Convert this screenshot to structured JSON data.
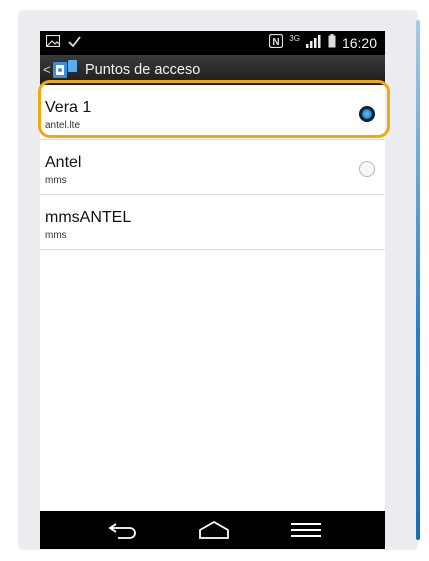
{
  "status_bar": {
    "icons": [
      "gallery-icon",
      "check-icon",
      "nfc-icon",
      "3g-icon",
      "signal-icon",
      "battery-icon"
    ],
    "network_label": "3G",
    "nfc_label": "N",
    "time": "16:20"
  },
  "action_bar": {
    "title": "Puntos de acceso",
    "back_glyph": "<"
  },
  "apn_list": [
    {
      "name": "Vera 1",
      "apn": "antel.lte",
      "selected": true
    },
    {
      "name": "Antel",
      "apn": "mms",
      "selected": false
    },
    {
      "name": "mmsANTEL",
      "apn": "mms",
      "selected": null
    }
  ],
  "nav_bar": {
    "buttons": [
      "back-icon",
      "home-icon",
      "menu-icon"
    ]
  },
  "colors": {
    "highlight": "#efab0b",
    "radio_selected": "#2b8fdc",
    "status_bar": "#000000"
  }
}
